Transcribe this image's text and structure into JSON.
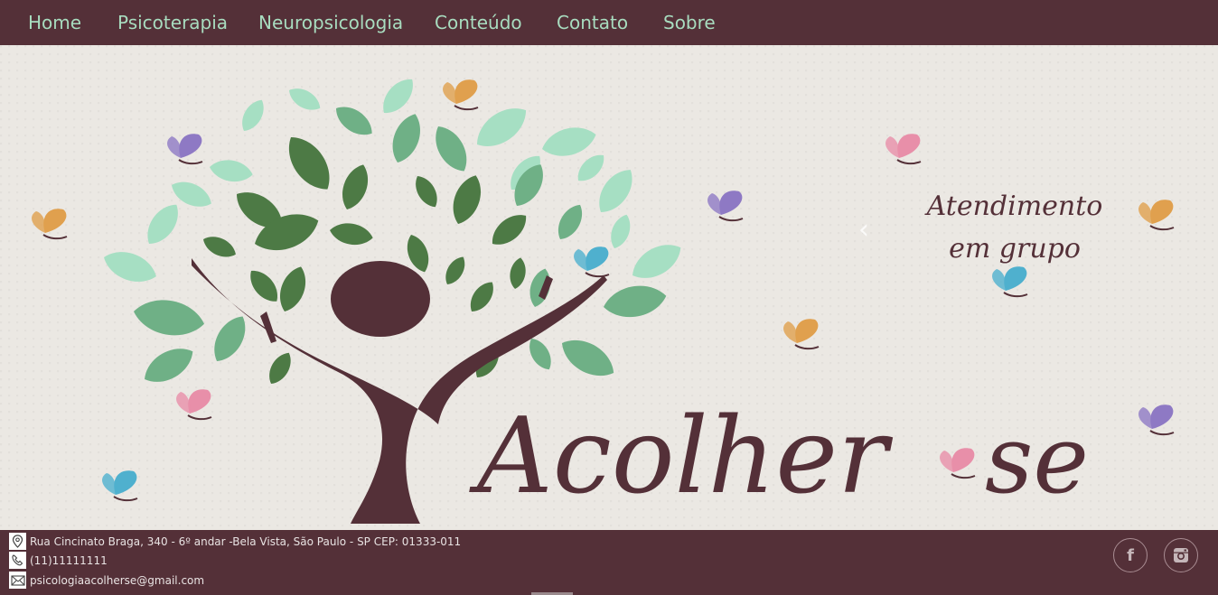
{
  "nav": {
    "items": [
      {
        "label": "Home"
      },
      {
        "label": "Psicoterapia"
      },
      {
        "label": "Neuropsicologia"
      },
      {
        "label": "Conteúdo"
      },
      {
        "label": "Contato"
      },
      {
        "label": "Sobre"
      }
    ]
  },
  "hero": {
    "brand_word_1": "Acolher",
    "brand_word_2": "se",
    "caption_line_1": "Atendimento",
    "caption_line_2": "em grupo",
    "prev_arrow": "‹"
  },
  "footer": {
    "address": "Rua Cincinato Braga, 340 - 6º andar -Bela Vista, São Paulo - SP CEP: 01333-011",
    "phone": "(11)11111111",
    "email": "psicologiaacolherse@gmail.com",
    "facebook_glyph": "f"
  },
  "colors": {
    "brand_brown": "#543038",
    "nav_text": "#a8dcbf",
    "leaf_dark": "#4d7a45",
    "leaf_mid": "#6fb086",
    "leaf_light": "#a6dfc3"
  },
  "icons": [
    "map-pin-icon",
    "phone-icon",
    "envelope-icon",
    "facebook-icon",
    "instagram-icon",
    "chevron-left-icon",
    "butterfly-icon"
  ]
}
